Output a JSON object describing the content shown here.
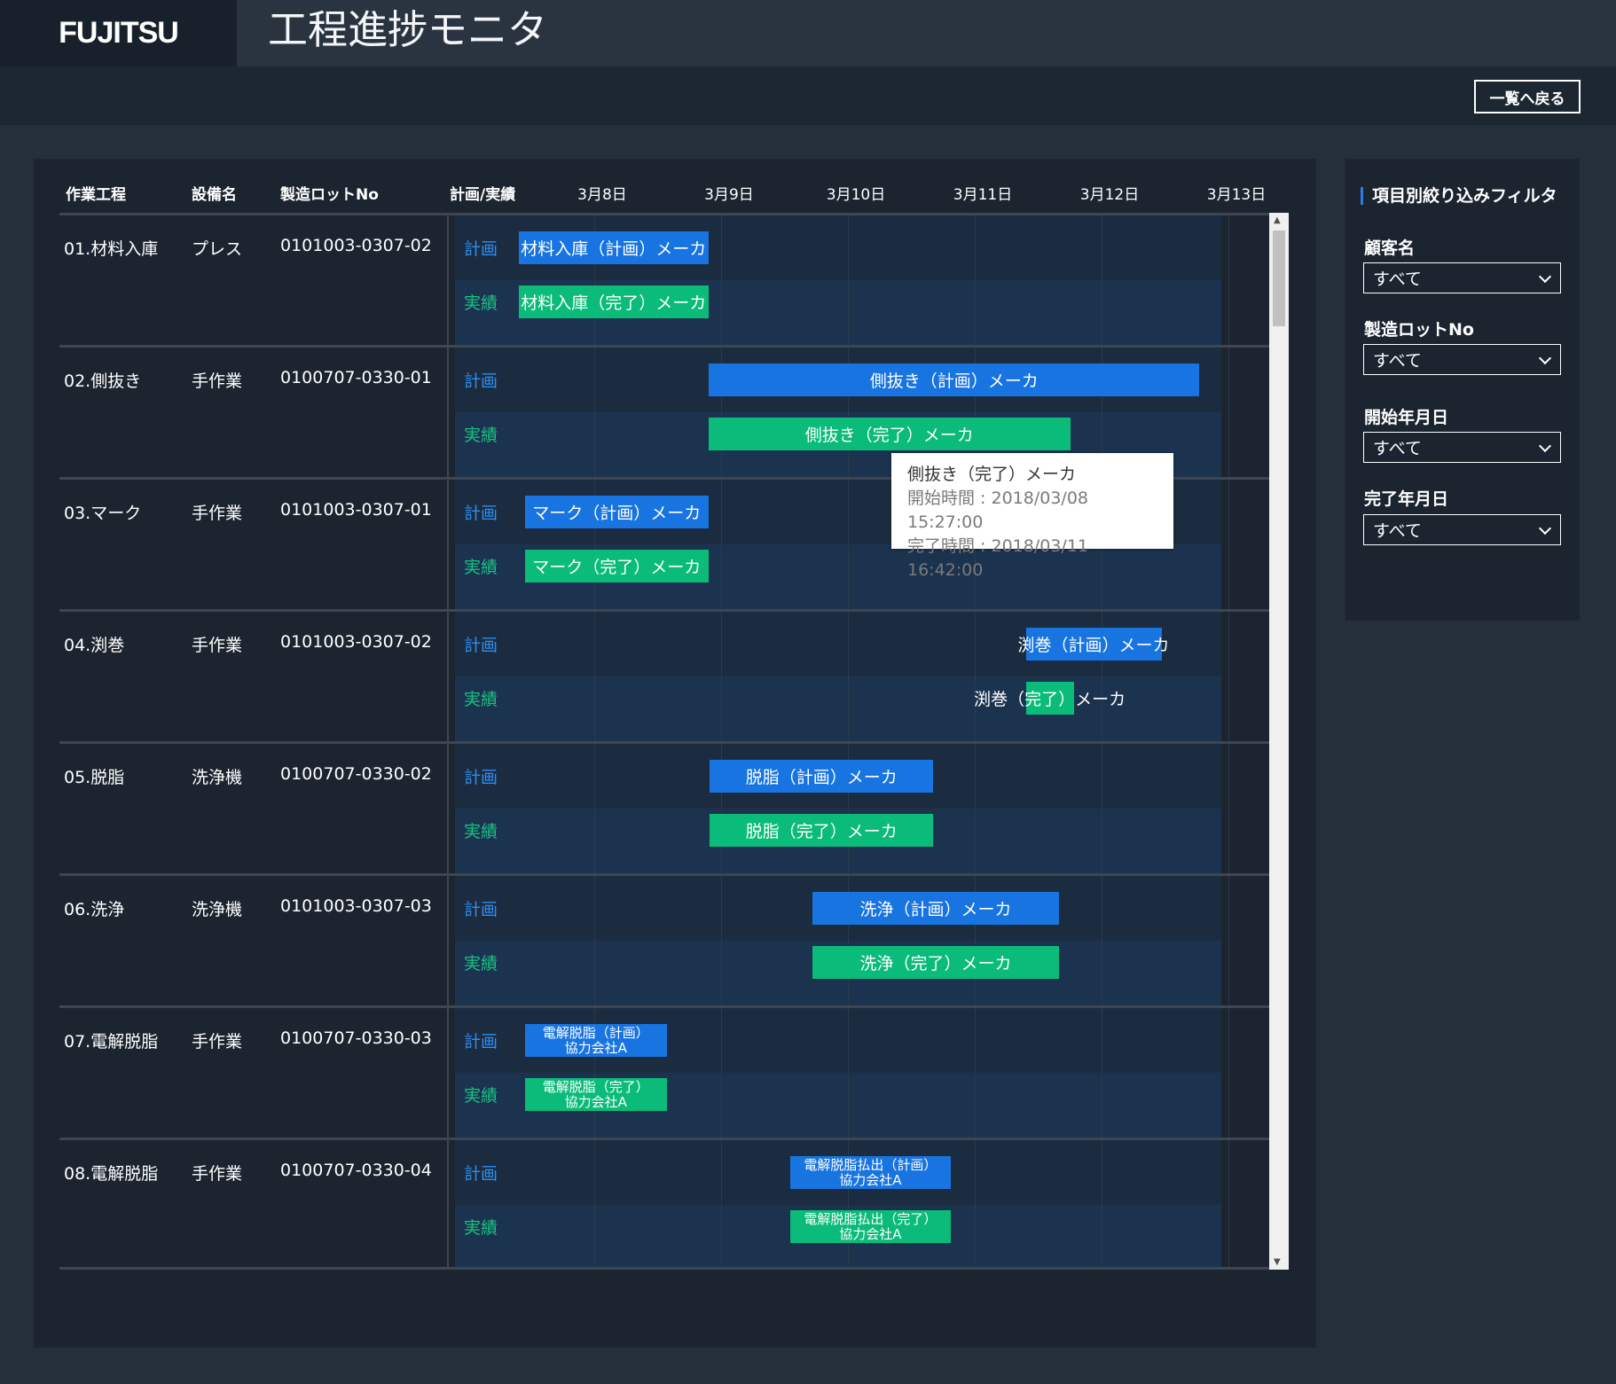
{
  "app": {
    "logo": "FUJITSU",
    "title": "工程進捗モニタ",
    "back_button": "一覧へ戻る"
  },
  "columns": {
    "process": "作業工程",
    "equipment": "設備名",
    "lot": "製造ロットNo",
    "type": "計画/実績"
  },
  "dates": [
    "3月8日",
    "3月9日",
    "3月10日",
    "3月11日",
    "3月12日",
    "3月13日"
  ],
  "rows": [
    {
      "process": "01.材料入庫",
      "equipment": "プレス",
      "lot": "0101003-0307-02",
      "plan_label": "計画",
      "actual_label": "実績",
      "plan": {
        "label": "材料入庫（計画）メーカ",
        "start": 7.9,
        "end": 9.4
      },
      "actual": {
        "label": "材料入庫（完了）メーカ",
        "start": 7.9,
        "end": 9.4
      }
    },
    {
      "process": "02.側抜き",
      "equipment": "手作業",
      "lot": "0100707-0330-01",
      "plan_label": "計画",
      "actual_label": "実績",
      "plan": {
        "label": "側抜き（計画）メーカ",
        "start": 9.4,
        "end": 13.27
      },
      "actual": {
        "label": "側抜き（完了）メーカ",
        "start": 9.4,
        "end": 12.25
      }
    },
    {
      "process": "03.マーク",
      "equipment": "手作業",
      "lot": "0101003-0307-01",
      "plan_label": "計画",
      "actual_label": "実績",
      "plan": {
        "label": "マーク（計画）メーカ",
        "start": 7.95,
        "end": 9.4
      },
      "actual": {
        "label": "マーク（完了）メーカ",
        "start": 7.95,
        "end": 9.4
      }
    },
    {
      "process": "04.渕巻",
      "equipment": "手作業",
      "lot": "0101003-0307-02",
      "plan_label": "計画",
      "actual_label": "実績",
      "plan": {
        "label": "渕巻（計画）メーカ",
        "start": 11.9,
        "end": 12.97
      },
      "actual": {
        "label": "渕巻（完了）メーカ",
        "start": 11.9,
        "end": 12.28
      }
    },
    {
      "process": "05.脱脂",
      "equipment": "洗浄機",
      "lot": "0100707-0330-02",
      "plan_label": "計画",
      "actual_label": "実績",
      "plan": {
        "label": "脱脂（計画）メーカ",
        "start": 9.41,
        "end": 11.17
      },
      "actual": {
        "label": "脱脂（完了）メーカ",
        "start": 9.41,
        "end": 11.17
      }
    },
    {
      "process": "06.洗浄",
      "equipment": "洗浄機",
      "lot": "0101003-0307-03",
      "plan_label": "計画",
      "actual_label": "実績",
      "plan": {
        "label": "洗浄（計画）メーカ",
        "start": 10.22,
        "end": 12.16
      },
      "actual": {
        "label": "洗浄（完了）メーカ",
        "start": 10.22,
        "end": 12.16
      }
    },
    {
      "process": "07.電解脱脂",
      "equipment": "手作業",
      "lot": "0100707-0330-03",
      "plan_label": "計画",
      "actual_label": "実績",
      "plan": {
        "label": "電解脱脂（計画）",
        "label2": "協力会社A",
        "start": 7.95,
        "end": 9.07
      },
      "actual": {
        "label": "電解脱脂（完了）",
        "label2": "協力会社A",
        "start": 7.95,
        "end": 9.07
      }
    },
    {
      "process": "08.電解脱脂",
      "equipment": "手作業",
      "lot": "0100707-0330-04",
      "plan_label": "計画",
      "actual_label": "実績",
      "plan": {
        "label": "電解脱脂払出（計画）",
        "label2": "協力会社A",
        "start": 10.04,
        "end": 11.31
      },
      "actual": {
        "label": "電解脱脂払出（完了）",
        "label2": "協力会社A",
        "start": 10.04,
        "end": 11.31
      }
    }
  ],
  "tooltip": {
    "title": "側抜き（完了）メーカ",
    "start": "開始時間 : 2018/03/08 15:27:00",
    "end": "完了時間 : 2018/03/11 16:42:00"
  },
  "filter": {
    "title": "項目別絞り込みフィルタ",
    "fields": [
      {
        "label": "顧客名",
        "value": "すべて"
      },
      {
        "label": "製造ロットNo",
        "value": "すべて"
      },
      {
        "label": "開始年月日",
        "value": "すべて"
      },
      {
        "label": "完了年月日",
        "value": "すべて"
      }
    ]
  },
  "colors": {
    "plan": "#1874e0",
    "actual": "#0bbb7a",
    "plan_text": "#2d8ef0",
    "actual_text": "#19c182",
    "background": "#252f3b"
  }
}
